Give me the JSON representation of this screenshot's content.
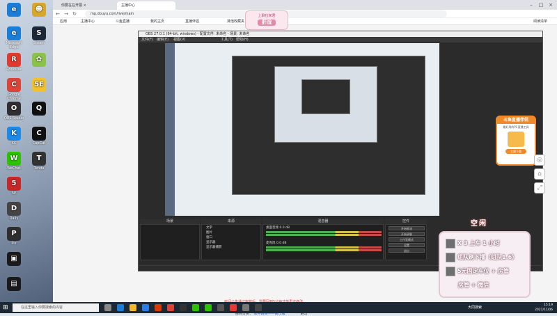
{
  "desktop": {
    "icons": [
      {
        "label": "Microsoft Edge",
        "glyph": "e",
        "color": "#1b7dd6"
      },
      {
        "label": "Steam",
        "glyph": "S",
        "color": "#1b2838"
      },
      {
        "label": "Rockstar",
        "glyph": "R",
        "color": "#f0b92e"
      },
      {
        "label": "Google Chrome",
        "glyph": "C",
        "color": "#db4437"
      },
      {
        "label": "OBS Studio",
        "glyph": "O",
        "color": "#302e31"
      },
      {
        "label": "KK",
        "glyph": "K",
        "color": "#1e88e5"
      },
      {
        "label": "WeChat",
        "glyph": "W",
        "color": "#2dc100"
      },
      {
        "label": "5E",
        "glyph": "5",
        "color": "#c62828"
      },
      {
        "label": "Daily",
        "glyph": "D",
        "color": "#444"
      },
      {
        "label": "CapCut",
        "glyph": "C",
        "color": "#111"
      },
      {
        "label": "Tenda",
        "glyph": "T",
        "color": "#333"
      },
      {
        "label": "Pix",
        "glyph": "P",
        "color": "#2e2e2e"
      }
    ]
  },
  "browser": {
    "tabs": [
      {
        "label": "你要在在开展 ×"
      },
      {
        "label": "主播中心"
      }
    ],
    "url": "mp.douyu.com/live/main",
    "bookmarks": [
      "应用",
      "主播中心",
      "斗鱼直播",
      "我的主页",
      "直播伴侣",
      "其他收藏夹",
      "阅读清单"
    ]
  },
  "obs": {
    "title": "OBS 27.0.1 (64-bit, windows) - 配置文件: 未命名 - 场景: 未命名",
    "menu": [
      "文件(F)",
      "编辑(E)",
      "视图(V)",
      "工具(T)",
      "帮助(H)"
    ],
    "panels": {
      "scenes": "场景",
      "sources": "来源",
      "mixer": "混音器",
      "controls": "控件"
    },
    "sources": [
      "文字",
      "图片",
      "窗口",
      "显示器",
      "显示器捕获"
    ],
    "mixer": [
      {
        "label": "桌面音频",
        "db": "0.0 dB"
      },
      {
        "label": "麦克风",
        "db": "0.0 dB"
      }
    ],
    "controls": [
      "开始推流",
      "开始录制",
      "工作室模式",
      "设置",
      "退出"
    ]
  },
  "overlay": {
    "badge_line1": "上聊拉家君",
    "badge_line2": "肝战",
    "status_title": "空闲",
    "rows": [
      "X 3 上车 1 小时",
      "组队刷下播（组队1.6）",
      "5元固定车位 + 房管",
      "房管 + 微信"
    ]
  },
  "ranking": {
    "title": "斗鱼直播伴侣",
    "subtitle": "最好用的PC直播工具",
    "button": "立即下载"
  },
  "page_notes": {
    "warning": "房间公告通过审核后，需要回到5分钟才能再次修改",
    "label": "房间分类：",
    "link": "和平精英——娱乐版",
    "action": "更改"
  },
  "taskbar": {
    "search_placeholder": "在这里输入你要搜索的内容",
    "time": "15:19",
    "date": "2021/11/06",
    "tray_label": "大同搜索"
  }
}
